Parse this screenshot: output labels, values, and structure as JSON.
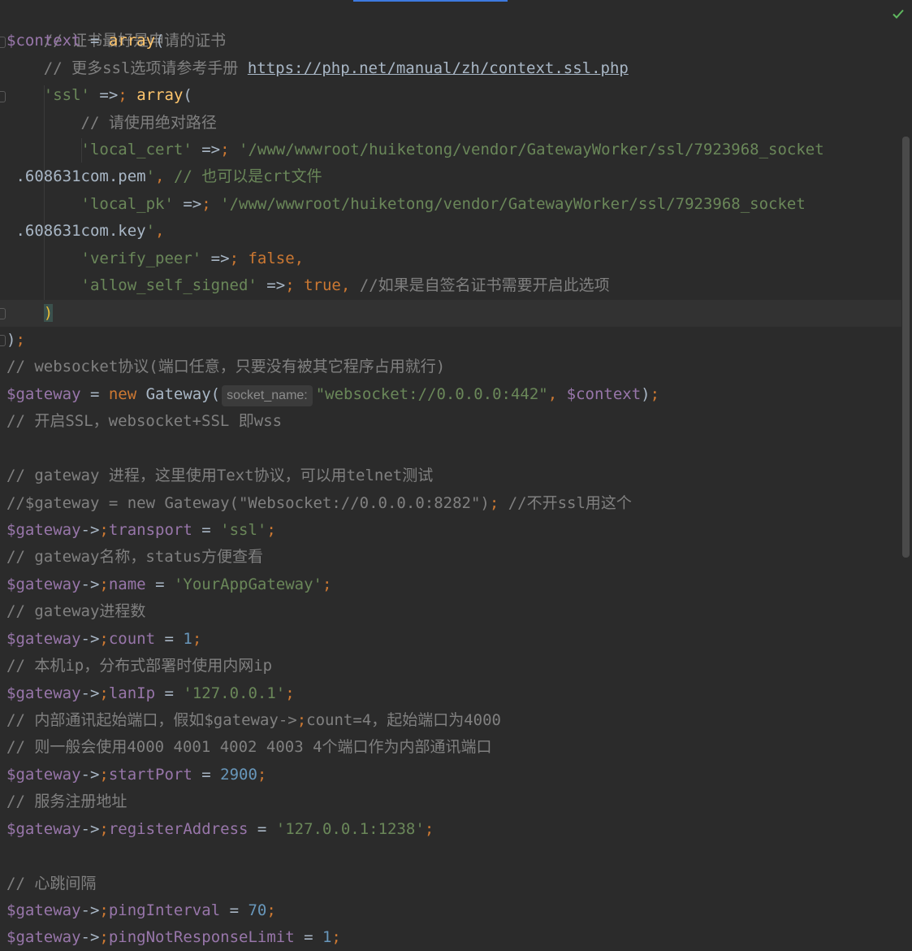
{
  "editor": {
    "inspection_status": "check-icon",
    "lines": [
      [
        "// 证书最好是申请的证书"
      ],
      [
        "$context = array("
      ],
      [
        "    // 更多ssl选项请参考手册 https://php.net/manual/zh/context.ssl.php"
      ],
      [
        "    'ssl' => array("
      ],
      [
        "        // 请使用绝对路径"
      ],
      [
        "        'local_cert' => '/www/wwwroot/huiketong/vendor/GatewayWorker/ssl/7923968_socket"
      ],
      [
        " .608631com.pem', // 也可以是crt文件"
      ],
      [
        "        'local_pk' => '/www/wwwroot/huiketong/vendor/GatewayWorker/ssl/7923968_socket"
      ],
      [
        " .608631com.key',"
      ],
      [
        "        'verify_peer' => false,"
      ],
      [
        "        'allow_self_signed' => true, //如果是自签名证书需要开启此选项"
      ],
      [
        "    )"
      ],
      [
        ");"
      ],
      [
        "// websocket协议(端口任意，只要没有被其它程序占用就行)"
      ],
      [
        "$gateway = new Gateway(",
        "socket_name:",
        "\"websocket://0.0.0.0:442\", $context);"
      ],
      [
        "// 开启SSL，websocket+SSL 即wss"
      ],
      [
        ""
      ],
      [
        "// gateway 进程，这里使用Text协议，可以用telnet测试"
      ],
      [
        "//$gateway = new Gateway(\"Websocket://0.0.0.0:8282\"); //不开ssl用这个"
      ],
      [
        "$gateway->transport = 'ssl';"
      ],
      [
        "// gateway名称，status方便查看"
      ],
      [
        "$gateway->name = 'YourAppGateway';"
      ],
      [
        "// gateway进程数"
      ],
      [
        "$gateway->count = 1;"
      ],
      [
        "// 本机ip，分布式部署时使用内网ip"
      ],
      [
        "$gateway->lanIp = '127.0.0.1';"
      ],
      [
        "// 内部通讯起始端口，假如$gateway->count=4，起始端口为4000"
      ],
      [
        "// 则一般会使用4000 4001 4002 4003 4个端口作为内部通讯端口"
      ],
      [
        "$gateway->startPort = 2900;"
      ],
      [
        "// 服务注册地址"
      ],
      [
        "$gateway->registerAddress = '127.0.0.1:1238';"
      ],
      [
        ""
      ],
      [
        "// 心跳间隔"
      ],
      [
        "$gateway->pingInterval = 70;"
      ],
      [
        "$gateway->pingNotResponseLimit = 1;"
      ]
    ]
  }
}
